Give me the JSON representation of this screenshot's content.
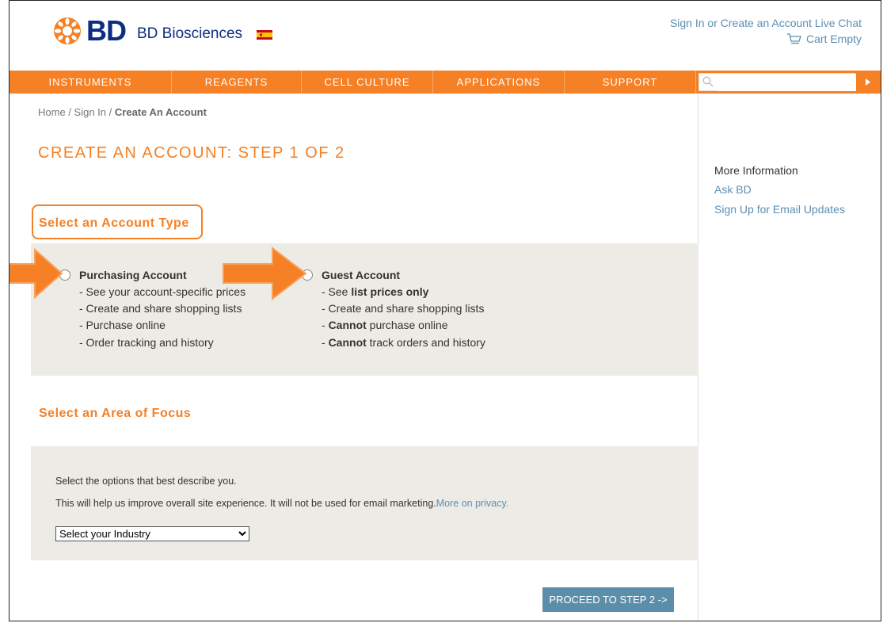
{
  "header": {
    "logo_text": "BD",
    "brand": "BD Biosciences",
    "sign_in": "Sign In or Create an Account",
    "live_chat": "Live Chat",
    "cart": "Cart Empty"
  },
  "nav": {
    "items": [
      "INSTRUMENTS",
      "REAGENTS",
      "CELL CULTURE",
      "APPLICATIONS",
      "SUPPORT"
    ],
    "search_placeholder": ""
  },
  "breadcrumb": {
    "home": "Home",
    "sign_in": "Sign In",
    "current": "Create An Account"
  },
  "page_title": "CREATE AN ACCOUNT: STEP 1 OF 2",
  "account_type": {
    "heading": "Select an Account Type",
    "purchasing": {
      "title": "Purchasing Account",
      "features": [
        "- See your account-specific prices",
        "- Create and share shopping lists",
        "- Purchase online",
        "- Order tracking and history"
      ]
    },
    "guest": {
      "title": "Guest Account",
      "f1_pre": "- See ",
      "f1_bold": "list prices only",
      "f2": "- Create and share shopping lists",
      "f3_pre": "- ",
      "f3_bold": "Cannot",
      "f3_post": " purchase online",
      "f4_pre": "- ",
      "f4_bold": "Cannot",
      "f4_post": " track orders and history"
    }
  },
  "focus": {
    "heading": "Select an Area of Focus",
    "line1": "Select the options that best describe you.",
    "line2": "This will help us improve overall site experience. It will not be used for email marketing.",
    "privacy_link": "More on privacy.",
    "industry_select": "Select your Industry"
  },
  "proceed_button": "PROCEED TO STEP 2  ->",
  "sidebar": {
    "heading": "More Information",
    "links": [
      "Ask BD",
      "Sign Up for Email Updates"
    ]
  },
  "colors": {
    "accent": "#f58025",
    "brand_blue": "#0c2d83",
    "link": "#5c8fb3",
    "panel": "#edebe5",
    "button": "#5b8fa9"
  }
}
